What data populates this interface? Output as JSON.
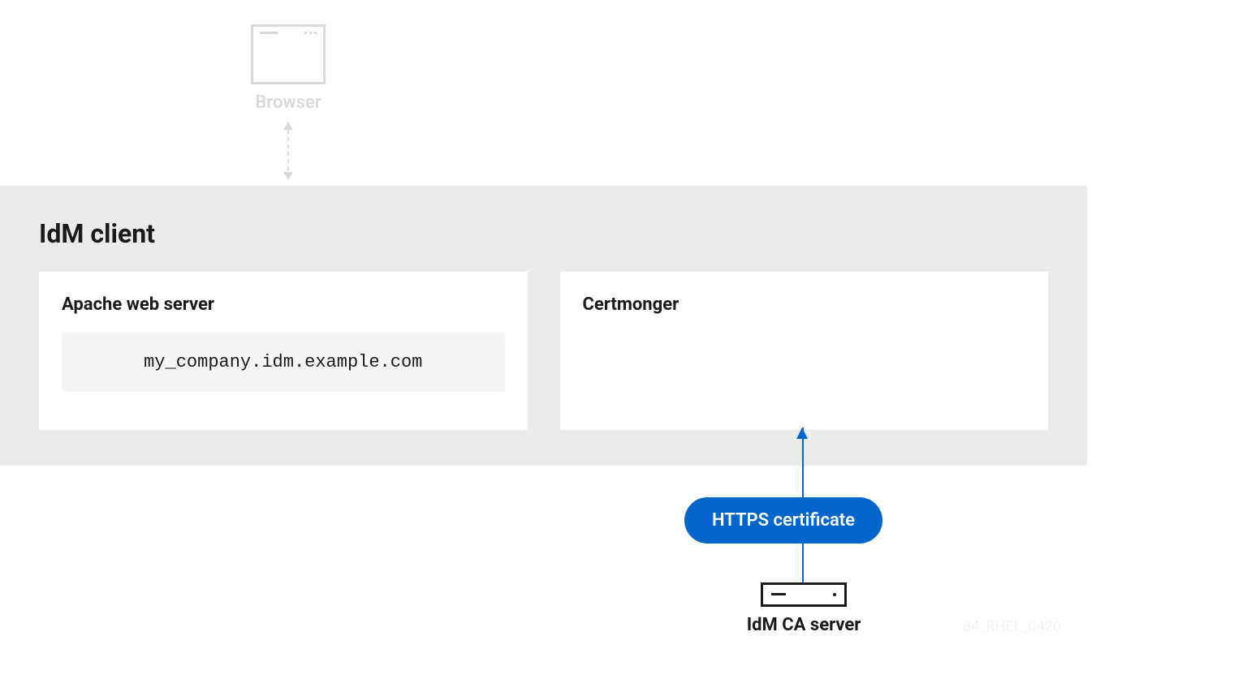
{
  "browser": {
    "label": "Browser"
  },
  "idm_client": {
    "title": "IdM client",
    "apache": {
      "title": "Apache web server",
      "hostname": "my_company.idm.example.com"
    },
    "certmonger": {
      "title": "Certmonger"
    }
  },
  "https_badge": "HTTPS certificate",
  "ca_server": {
    "label": "IdM CA server"
  },
  "watermark": "84_RHEL_0420",
  "colors": {
    "accent": "#0066cc",
    "bg_gray": "#ebebeb",
    "text": "#1a1a1a"
  }
}
